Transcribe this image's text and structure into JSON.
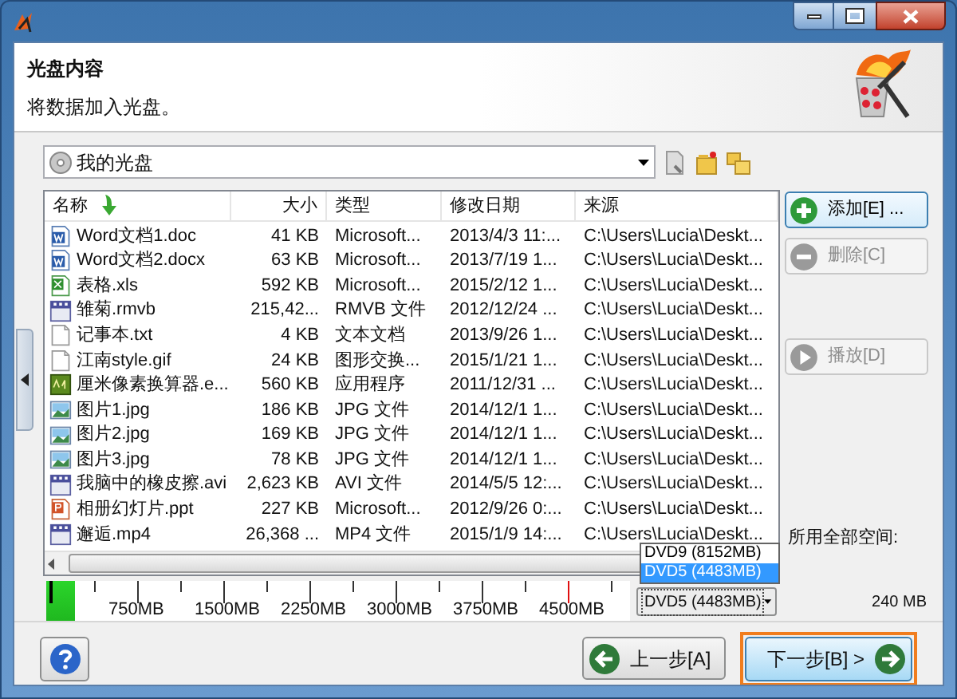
{
  "header": {
    "title": "光盘内容",
    "subtitle": "将数据加入光盘。"
  },
  "disc_selector": {
    "value": "我的光盘"
  },
  "file_list": {
    "columns": [
      "名称",
      "大小",
      "类型",
      "修改日期",
      "来源"
    ],
    "rows": [
      {
        "kind": "word",
        "name": "Word文档1.doc",
        "size": "41 KB",
        "type": "Microsoft...",
        "date": "2013/4/3 11:...",
        "source": "C:\\Users\\Lucia\\Deskt..."
      },
      {
        "kind": "word",
        "name": "Word文档2.docx",
        "size": "63 KB",
        "type": "Microsoft...",
        "date": "2013/7/19 1...",
        "source": "C:\\Users\\Lucia\\Deskt..."
      },
      {
        "kind": "excel",
        "name": "表格.xls",
        "size": "592 KB",
        "type": "Microsoft...",
        "date": "2015/2/12 1...",
        "source": "C:\\Users\\Lucia\\Deskt..."
      },
      {
        "kind": "video",
        "name": "雏菊.rmvb",
        "size": "215,42...",
        "type": "RMVB 文件",
        "date": "2012/12/24 ...",
        "source": "C:\\Users\\Lucia\\Deskt..."
      },
      {
        "kind": "text",
        "name": "记事本.txt",
        "size": "4 KB",
        "type": "文本文档",
        "date": "2013/9/26 1...",
        "source": "C:\\Users\\Lucia\\Deskt..."
      },
      {
        "kind": "text",
        "name": "江南style.gif",
        "size": "24 KB",
        "type": "图形交换...",
        "date": "2015/1/21 1...",
        "source": "C:\\Users\\Lucia\\Deskt..."
      },
      {
        "kind": "app",
        "name": "厘米像素换算器.e...",
        "size": "560 KB",
        "type": "应用程序",
        "date": "2011/12/31 ...",
        "source": "C:\\Users\\Lucia\\Deskt..."
      },
      {
        "kind": "image",
        "name": "图片1.jpg",
        "size": "186 KB",
        "type": "JPG 文件",
        "date": "2014/12/1 1...",
        "source": "C:\\Users\\Lucia\\Deskt..."
      },
      {
        "kind": "image",
        "name": "图片2.jpg",
        "size": "169 KB",
        "type": "JPG 文件",
        "date": "2014/12/1 1...",
        "source": "C:\\Users\\Lucia\\Deskt..."
      },
      {
        "kind": "image",
        "name": "图片3.jpg",
        "size": "78 KB",
        "type": "JPG 文件",
        "date": "2014/12/1 1...",
        "source": "C:\\Users\\Lucia\\Deskt..."
      },
      {
        "kind": "video",
        "name": "我脑中的橡皮擦.avi",
        "size": "2,623 KB",
        "type": "AVI 文件",
        "date": "2014/5/5 12:...",
        "source": "C:\\Users\\Lucia\\Deskt..."
      },
      {
        "kind": "powerpoint",
        "name": "相册幻灯片.ppt",
        "size": "227 KB",
        "type": "Microsoft...",
        "date": "2012/9/26 0:...",
        "source": "C:\\Users\\Lucia\\Deskt..."
      },
      {
        "kind": "video",
        "name": "邂逅.mp4",
        "size": "26,368 ...",
        "type": "MP4 文件",
        "date": "2015/1/9 14:...",
        "source": "C:\\Users\\Lucia\\Deskt..."
      }
    ]
  },
  "side_buttons": [
    {
      "label": "添加[E] ...",
      "kind": "add",
      "disabled": false
    },
    {
      "label": "删除[C]",
      "kind": "remove",
      "disabled": true
    },
    {
      "label": "播放[D]",
      "kind": "play",
      "disabled": true
    }
  ],
  "capacity": {
    "level": 0.05,
    "scale": [
      "750MB",
      "1500MB",
      "2250MB",
      "3000MB",
      "3750MB",
      "4500MB"
    ]
  },
  "disc_type": {
    "value": "DVD5 (4483MB)",
    "options": [
      {
        "label": "DVD9 (8152MB)",
        "selected": false
      },
      {
        "label": "DVD5 (4483MB)",
        "selected": true
      }
    ]
  },
  "space_used": {
    "label": "所用全部空间:",
    "value": "240 MB"
  },
  "footer": {
    "back": "上一步[A]",
    "next": "下一步[B] >"
  }
}
